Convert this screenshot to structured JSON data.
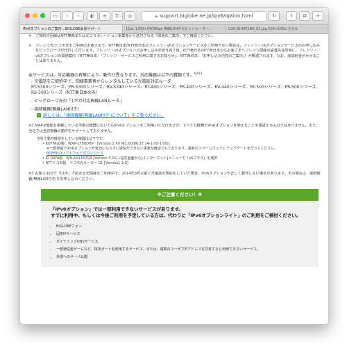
{
  "address": {
    "url": "support.biglobe.ne.jp/ipv6/option.html"
  },
  "tabs": [
    "IPv6オプションのご案内 : BIGLOBE会員サポート",
    "11ac 1300+450Mbps 無線LANギガビットルーター...",
    "U2H-SL48F1BK_01.jpg 500×500ピクセル"
  ],
  "notes": {
    "n1": "ご契約の回線はNTT東西または光コラボレーション事業者から送付される「開通のご案内」でご確認ください。",
    "n2": "フレッツ光/ドコモ光をご利用のお客さまで、NTT東日本/NTT西日本のフレッツ・v6オプションサービスをご利用でない場合は、フレッツ・v6オプションサービスのお申し込みをビッグローブが代行して行います。フレッツ・v6オプションのお申し込み手続き完了後、NTT東日本/NTT西日本からお客さまへフレッツ回線の設置先住所宛に、フレッツ・v6オプションの開通案内（NTT東日本：「フレッツ・サービスご利用に関するお知らせ」、NTT西日本：「お申し込み内容のご案内」）が郵送されます。なお、追加料金がかかることはありません。"
  },
  "service": {
    "intro": "本サービスは、対応機器の有無により、動作が異なります。対応機器は以下の種類です。",
    "intro_sup": "※2※3",
    "item1": "- 光電話をご契約中で、回線事業者からレンタルしている光電話対応ルータ",
    "item1_models": "RT-S300シリーズ、PR-S300シリーズ、RV-S340シリーズ、RT-400シリーズ、PR-400シリーズ、RV-440シリーズ、RT-500シリーズ、PR-500シリーズ、RS-500シリーズ（NTT東日本のみ）",
    "item2": "- ビッグローブ光の「1ギガ対応無線LANルータ」",
    "item3": "- 接続機器(無線LAN付き)",
    "link": "詳しくは、「接続機器(無線LAN付き)について」をご覧ください。"
  },
  "note2": {
    "text": "※2 MAP-E機能を搭載している市販の機器においてもIPv6オプションをご利用いただけますが、すべての機種でIPv6オプションを使えることを保証するものではありません。また、当社では当該機器の動作をサポートしておりません。",
    "sub": "当社で動作確認をしている機器は以下です。",
    "dev1": "BUFFALO製　WXR-1750DHP　[Version 2.49 (R1.00/86.37.14-1.00-1.00)]",
    "dev1_note": "※一部地域でIPv6オプションが有効にならずに通信ができない事象が確認されております。最新のファームウェアにアップデートを行ってください。",
    "dev1_link": "BUFFALOソフトウェアダウンロード",
    "dev2": "IO DATA製　WN-AX1167GR [Version 3.21]→設定画面から[インターネット]メニューで「v6プラス」を選択",
    "dev3": "NTTドコモ製　ドコモ光ルーター 01 [Version1.3.0]"
  },
  "note3": "※3 お客さまIDで「CDP」で始まる光回線をご利用中で、2014年9月以前に光電話の契約をしていた場合、IPv6オプションが正しく動作しない場合があります。その場合は、接続機器(無線LAN付き)をお申し込みください。",
  "notice": {
    "banner": "※ご注意ください！※",
    "warn1": "「IPv6オプション」では一部利用できないサービスがあります。",
    "warn2": "すでに利用中、もしくは今後ご利用を予定している方は、代わりに「IPv6オプションライト」のご利用をご検討ください。",
    "items": [
      "BIGLOBEフォン",
      "固定IPサービス",
      "ダイナミックDNSサービス",
      "一部通信型ゲームなど、特定ポートを使用するサービス、または、複数のユーザでIPアドレスを共有すると利用できないサービス。",
      "外部へのサーバ公開"
    ]
  },
  "colors": {
    "accent": "#5aa52c",
    "link": "#1a6ab0"
  },
  "icons": [
    "back-icon",
    "forward-icon",
    "sidebar-icon",
    "lock-icon",
    "reload-icon",
    "share-icon",
    "tabs-icon",
    "add-tab-icon"
  ]
}
